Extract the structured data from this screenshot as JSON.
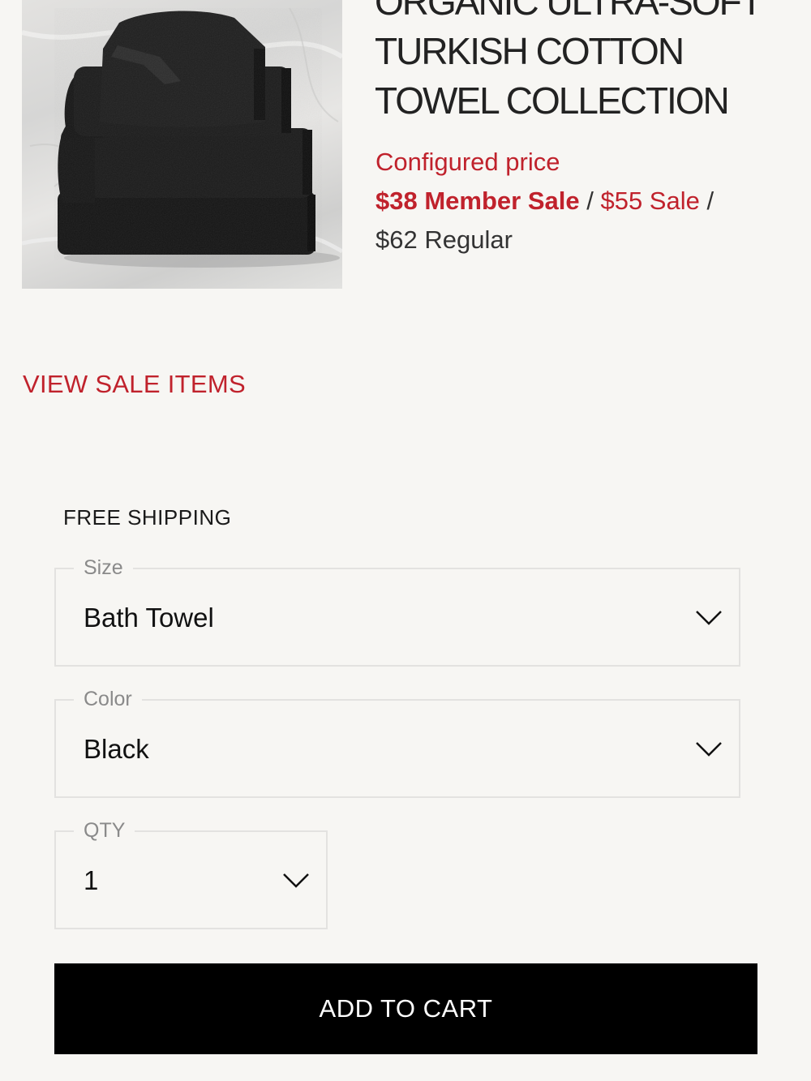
{
  "product": {
    "title_lines": [
      "ORGANIC ULTRA-SOFT",
      "TURKISH COTTON",
      "TOWEL COLLECTION"
    ],
    "image_alt": "Black towel stack"
  },
  "pricing": {
    "configured_label": "Configured price",
    "member_sale": "$38 Member Sale",
    "separator": "/",
    "sale": "$55 Sale",
    "regular": "$62 Regular",
    "accent_color": "#c0222c"
  },
  "links": {
    "view_sale_items": "VIEW SALE ITEMS"
  },
  "shipping": {
    "label": "FREE SHIPPING"
  },
  "options": {
    "size": {
      "label": "Size",
      "value": "Bath Towel"
    },
    "color": {
      "label": "Color",
      "value": "Black"
    },
    "qty": {
      "label": "QTY",
      "value": "1"
    }
  },
  "actions": {
    "add_to_cart": "ADD TO CART"
  },
  "icons": {
    "dropdown": "chevron-down-icon"
  }
}
